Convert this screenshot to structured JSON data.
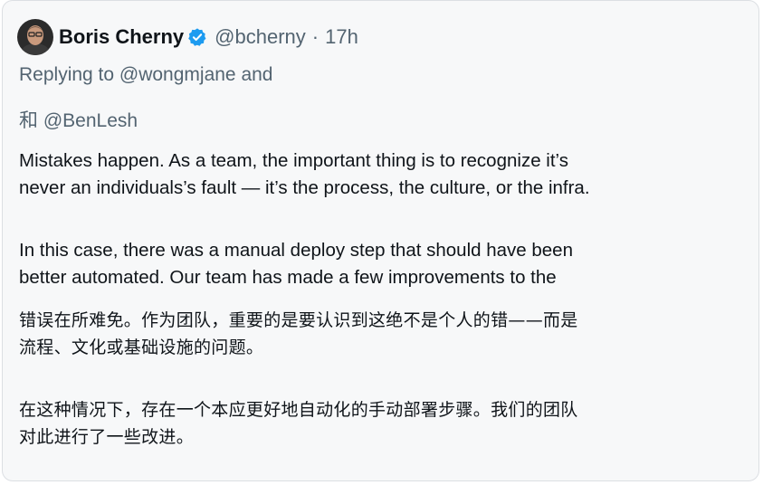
{
  "tweet": {
    "author_name": "Boris Cherny",
    "handle": "@bcherny",
    "separator": "·",
    "time": "17h",
    "verified_icon": "verified-badge-icon",
    "replying_line1": "Replying to @wongmjane and",
    "replying_line2": "和 @BenLesh",
    "english_para1": {
      "line1": "Mistakes happen. As a team, the important thing is to recognize it’s",
      "line2": "never an individuals’s fault — it’s the process, the culture, or the infra."
    },
    "english_para2": {
      "line1": "In this case, there was a manual deploy step that should have been",
      "line2": "better automated. Our team has made a few improvements to the"
    },
    "chinese_para1": {
      "line1": "错误在所难免。作为团队，重要的是要认识到这绝不是个人的错——而是",
      "line2": "流程、文化或基础设施的问题。"
    },
    "chinese_para2": {
      "line1": "在这种情况下，存在一个本应更好地自动化的手动部署步骤。我们的团队",
      "line2": "对此进行了一些改进。"
    }
  },
  "colors": {
    "card_background": "#f7f8f9",
    "primary_text": "#0f1419",
    "secondary_text": "#536471",
    "verified_blue": "#1d9bf0"
  }
}
